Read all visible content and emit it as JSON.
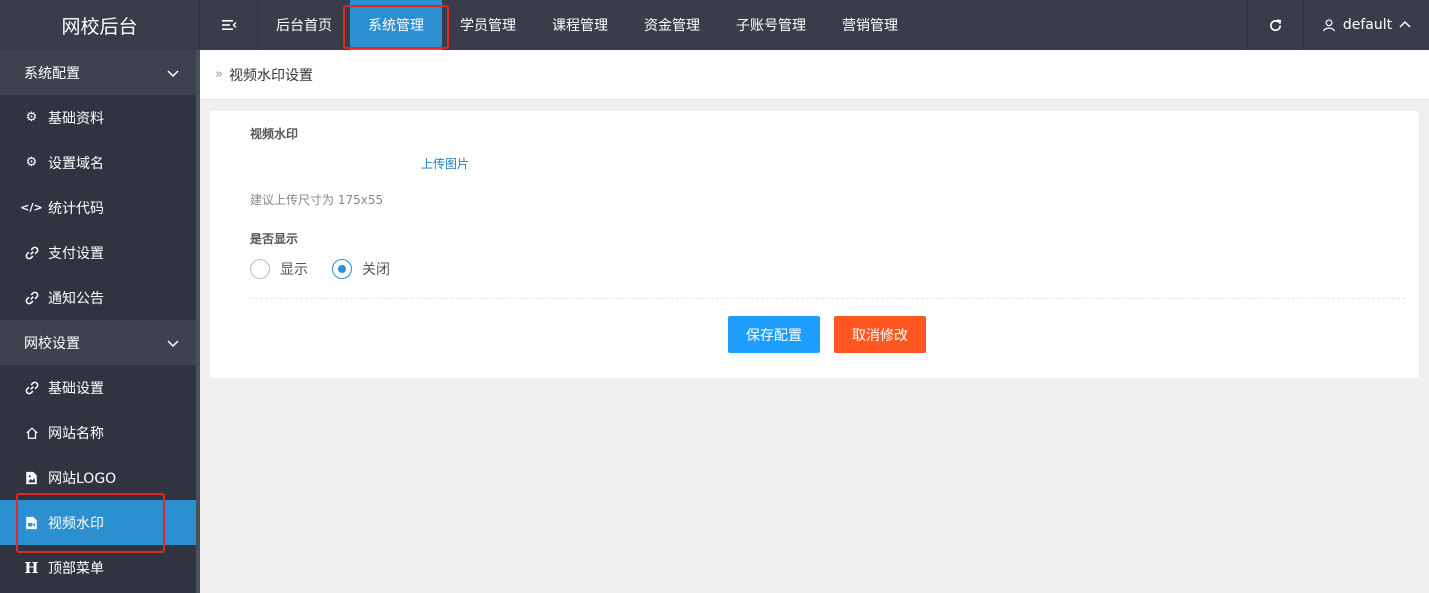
{
  "header": {
    "logo": "网校后台",
    "nav": [
      "后台首页",
      "系统管理",
      "学员管理",
      "课程管理",
      "资金管理",
      "子账号管理",
      "营销管理"
    ],
    "active_nav": "系统管理",
    "user": "default"
  },
  "sidebar": {
    "groups": [
      {
        "title": "系统配置",
        "items": [
          {
            "label": "基础资料",
            "icon": "gear-icon"
          },
          {
            "label": "设置域名",
            "icon": "gear-icon"
          },
          {
            "label": "统计代码",
            "icon": "code-icon"
          },
          {
            "label": "支付设置",
            "icon": "link-icon"
          },
          {
            "label": "通知公告",
            "icon": "link-icon"
          }
        ]
      },
      {
        "title": "网校设置",
        "items": [
          {
            "label": "基础设置",
            "icon": "link-icon"
          },
          {
            "label": "网站名称",
            "icon": "home-icon"
          },
          {
            "label": "网站LOGO",
            "icon": "image-icon"
          },
          {
            "label": "视频水印",
            "icon": "video-file-icon",
            "active": true
          },
          {
            "label": "顶部菜单",
            "icon": "heading-icon"
          }
        ]
      }
    ]
  },
  "breadcrumb": "视频水印设置",
  "form": {
    "watermark_label": "视频水印",
    "upload_link": "上传图片",
    "hint": "建议上传尺寸为 175x55",
    "display_label": "是否显示",
    "options": [
      {
        "label": "显示",
        "checked": false
      },
      {
        "label": "关闭",
        "checked": true
      }
    ],
    "save_button": "保存配置",
    "cancel_button": "取消修改"
  },
  "colors": {
    "header_bg": "#393d49",
    "sidebar_bg": "#2f3440",
    "active_blue": "#2b8fd0",
    "save_btn": "#1e9fff",
    "cancel_btn": "#ff5722",
    "highlight_box": "#e32626"
  }
}
